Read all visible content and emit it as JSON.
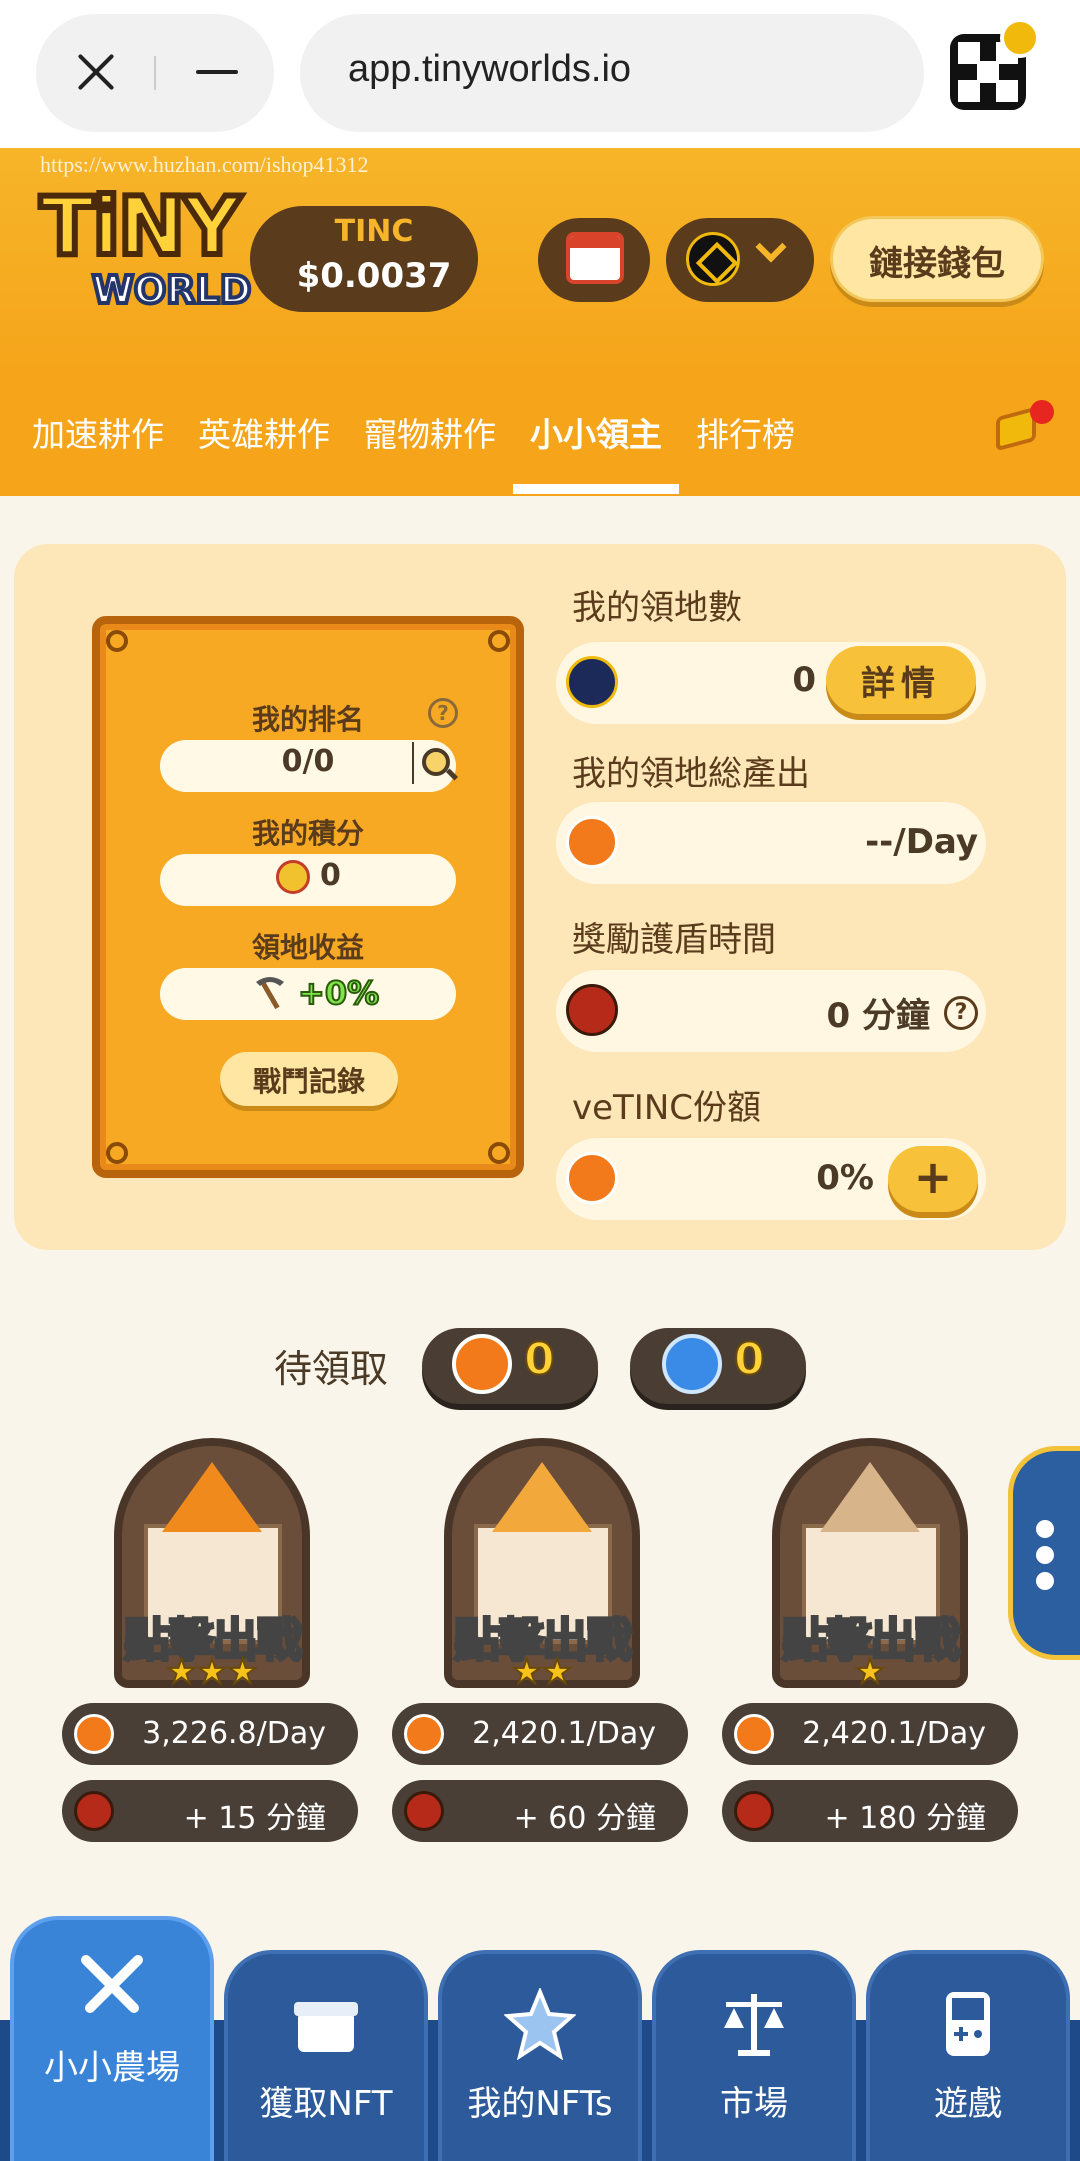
{
  "browser": {
    "url": "app.tinyworlds.io"
  },
  "watermark": "https://www.huzhan.com/ishop41312",
  "header": {
    "logo_top": "TiNY",
    "logo_bottom": "WORLD",
    "token_label": "TINC",
    "token_price": "$0.0037",
    "wallet_button": "鏈接錢包"
  },
  "tabs": [
    "加速耕作",
    "英雄耕作",
    "寵物耕作",
    "小小領主",
    "排行榜"
  ],
  "active_tab": "小小領主",
  "card": {
    "rank_label": "我的排名",
    "rank_value": "0/0",
    "points_label": "我的積分",
    "points_value": "0",
    "yield_label": "領地收益",
    "yield_value": "+0%",
    "battle_button": "戰鬥記錄"
  },
  "stats": {
    "territories_label": "我的領地數",
    "territories_value": "0",
    "details_button": "詳情",
    "output_label": "我的領地総產出",
    "output_value": "--/Day",
    "shield_label": "獎勵護盾時間",
    "shield_value": "0 分鐘",
    "vetinc_label": "veTINC份額",
    "vetinc_value": "0%",
    "plus_button": "+"
  },
  "pending": {
    "label": "待領取",
    "tinc_value": "0",
    "orb_value": "0"
  },
  "castles": [
    {
      "stars": "★★★",
      "action": "點擊出戰",
      "output": "3,226.8/Day",
      "shield": "+ 15 分鐘"
    },
    {
      "stars": "★★",
      "action": "點擊出戰",
      "output": "2,420.1/Day",
      "shield": "+ 60 分鐘"
    },
    {
      "stars": "★",
      "action": "點擊出戰",
      "output": "2,420.1/Day",
      "shield": "+ 180 分鐘"
    }
  ],
  "nav": [
    "小小農場",
    "獲取NFT",
    "我的NFTs",
    "市場",
    "遊戲"
  ],
  "colors": {
    "primary": "#f6a51b",
    "nav": "#2c5a9a",
    "nav_active": "#3a84d8"
  }
}
